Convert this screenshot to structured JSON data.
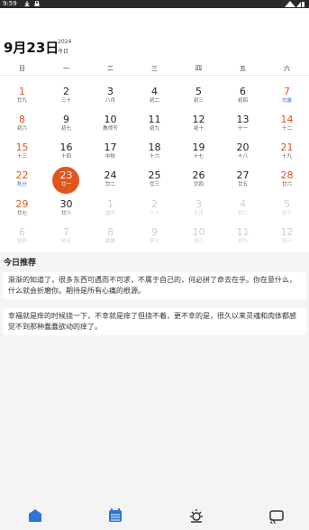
{
  "status_bar": {
    "time": "9:59"
  },
  "header": {
    "date_title": "9月23日",
    "year": "2024",
    "today_label": "今日"
  },
  "weekdays": [
    "日",
    "一",
    "二",
    "三",
    "四",
    "五",
    "六"
  ],
  "weeks": [
    [
      {
        "d": "1",
        "l": "廿九",
        "w": 1
      },
      {
        "d": "2",
        "l": "三十"
      },
      {
        "d": "3",
        "l": "八月"
      },
      {
        "d": "4",
        "l": "初二"
      },
      {
        "d": "5",
        "l": "初三"
      },
      {
        "d": "6",
        "l": "初四"
      },
      {
        "d": "7",
        "l": "白露",
        "w": 1,
        "b": 1
      }
    ],
    [
      {
        "d": "8",
        "l": "初六",
        "w": 1
      },
      {
        "d": "9",
        "l": "初七"
      },
      {
        "d": "10",
        "l": "教师节"
      },
      {
        "d": "11",
        "l": "初九"
      },
      {
        "d": "12",
        "l": "初十"
      },
      {
        "d": "13",
        "l": "十一"
      },
      {
        "d": "14",
        "l": "十二",
        "w": 1
      }
    ],
    [
      {
        "d": "15",
        "l": "十三",
        "w": 1
      },
      {
        "d": "16",
        "l": "十四"
      },
      {
        "d": "17",
        "l": "中秋"
      },
      {
        "d": "18",
        "l": "十六"
      },
      {
        "d": "19",
        "l": "十七"
      },
      {
        "d": "20",
        "l": "十八"
      },
      {
        "d": "21",
        "l": "十九",
        "w": 1
      }
    ],
    [
      {
        "d": "22",
        "l": "秋分",
        "w": 1,
        "b": 1
      },
      {
        "d": "23",
        "l": "廿一",
        "s": 1
      },
      {
        "d": "24",
        "l": "廿二"
      },
      {
        "d": "25",
        "l": "廿三"
      },
      {
        "d": "26",
        "l": "廿四"
      },
      {
        "d": "27",
        "l": "廿五"
      },
      {
        "d": "28",
        "l": "廿六",
        "w": 1
      }
    ],
    [
      {
        "d": "29",
        "l": "廿七",
        "w": 1
      },
      {
        "d": "30",
        "l": "廿八"
      },
      {
        "d": "1",
        "l": "国庆",
        "f": 1
      },
      {
        "d": "2",
        "l": "三十",
        "f": 1
      },
      {
        "d": "3",
        "l": "九月",
        "f": 1
      },
      {
        "d": "4",
        "l": "初二",
        "f": 1
      },
      {
        "d": "5",
        "l": "初三",
        "f": 1
      }
    ],
    [
      {
        "d": "6",
        "l": "初四",
        "f": 1
      },
      {
        "d": "7",
        "l": "初五",
        "f": 1
      },
      {
        "d": "8",
        "l": "寒露",
        "f": 1
      },
      {
        "d": "9",
        "l": "初七",
        "f": 1
      },
      {
        "d": "10",
        "l": "初八",
        "f": 1
      },
      {
        "d": "11",
        "l": "初九",
        "f": 1
      },
      {
        "d": "12",
        "l": "初十",
        "f": 1
      }
    ]
  ],
  "recommend": {
    "title": "今日推荐",
    "card1": "渐渐的知道了，很多东西可遇而不可求，不属于自己的，何必拼了命去在乎。你在意什么，什么就会折磨你。期待是所有心痛的根源。",
    "card2": "幸福就是痒的时候挠一下，不幸就是痒了但挠不着，更不幸的是，很久以来灵魂和肉体都感觉不到那种蠢蠢欲动的痒了。"
  },
  "colors": {
    "accent": "#e0561c",
    "blue": "#2c74d6"
  }
}
